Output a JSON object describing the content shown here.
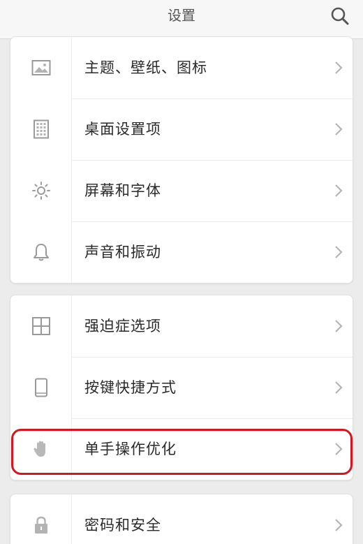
{
  "header": {
    "title": "设置",
    "search_icon": "search-icon"
  },
  "groups": [
    {
      "items": [
        {
          "label": "主题、壁纸、图标",
          "icon": "image-icon"
        },
        {
          "label": "桌面设置项",
          "icon": "grid-icon"
        },
        {
          "label": "屏幕和字体",
          "icon": "brightness-icon"
        },
        {
          "label": "声音和振动",
          "icon": "bell-icon"
        }
      ]
    },
    {
      "items": [
        {
          "label": "强迫症选项",
          "icon": "four-squares-icon"
        },
        {
          "label": "按键快捷方式",
          "icon": "phone-icon"
        },
        {
          "label": "单手操作优化",
          "icon": "hand-icon",
          "highlighted": true
        }
      ]
    },
    {
      "items": [
        {
          "label": "密码和安全",
          "icon": "lock-icon"
        }
      ]
    }
  ],
  "colors": {
    "highlight": "#d6161e",
    "icon": "#9a9a9a",
    "chevron": "#b5b5b5"
  }
}
